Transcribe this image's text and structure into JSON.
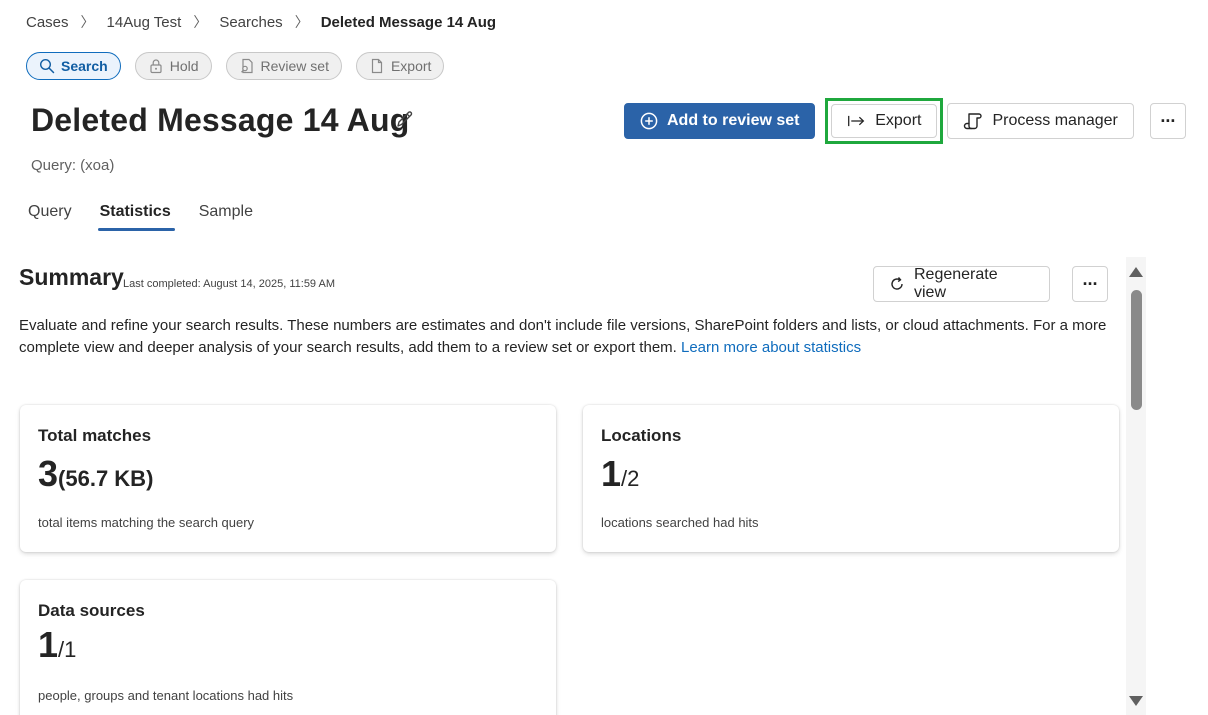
{
  "breadcrumb": [
    "Cases",
    "14Aug Test",
    "Searches",
    "Deleted Message 14 Aug"
  ],
  "steps": {
    "search": "Search",
    "hold": "Hold",
    "review_set": "Review set",
    "export": "Export"
  },
  "title": "Deleted Message 14 Aug",
  "query_line": "Query: (xoa)",
  "actions": {
    "add_to_review_set": "Add to review set",
    "export": "Export",
    "process_manager": "Process manager",
    "more": "···"
  },
  "tabs": {
    "query": "Query",
    "statistics": "Statistics",
    "sample": "Sample"
  },
  "summary": {
    "title": "Summary",
    "last_completed": "Last completed: August 14, 2025, 11:59 AM",
    "regenerate": "Regenerate view",
    "more": "···",
    "description": "Evaluate and refine your search results. These numbers are estimates and don't include file versions, SharePoint folders and lists, or cloud attachments. For a more complete view and deeper analysis of your search results, add them to a review set or export them.",
    "learn_more": "Learn more about statistics"
  },
  "cards": {
    "total_matches": {
      "title": "Total matches",
      "value": "3",
      "size": "(56.7 KB)",
      "caption": "total items matching the search query"
    },
    "locations": {
      "title": "Locations",
      "value": "1",
      "total": "/2",
      "caption": "locations searched had hits"
    },
    "data_sources": {
      "title": "Data sources",
      "value": "1",
      "total": "/1",
      "caption": "people, groups and tenant locations had hits"
    }
  },
  "colors": {
    "primary": "#2b63a8",
    "link": "#0f6cbd",
    "highlight_frame": "#1fa83d"
  }
}
